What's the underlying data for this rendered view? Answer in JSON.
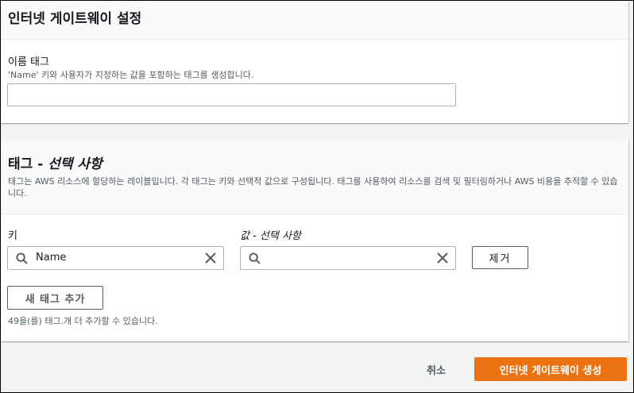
{
  "settings_panel": {
    "title": "인터넷 게이트웨이 설정",
    "name_tag": {
      "label": "이름 태그",
      "description": "'Name' 키와 사용자가 지정하는 값을 포함하는 태그를 생성합니다.",
      "value": "",
      "placeholder": ""
    }
  },
  "tags_panel": {
    "title_main": "태그 - ",
    "title_optional": "선택 사항",
    "description": "태그는 AWS 리소스에 할당하는 레이블입니다. 각 태그는 키와 선택적 값으로 구성됩니다. 태그를 사용하여 리소스를 검색 및 필터링하거나 AWS 비용을 추적할 수 있습니다.",
    "key_label": "키",
    "value_label": "값 - 선택 사항",
    "key_value": "Name",
    "value_value": "",
    "remove_label": "제거",
    "add_label": "새 태그 추가",
    "limit_text": "49을(를) 태그.개 더 추가할 수 있습니다."
  },
  "footer": {
    "cancel_label": "취소",
    "create_label": "인터넷 게이트웨이 생성"
  },
  "colors": {
    "primary_button": "#ec7211",
    "panel_bg": "#ffffff",
    "page_bg": "#f2f3f3"
  }
}
